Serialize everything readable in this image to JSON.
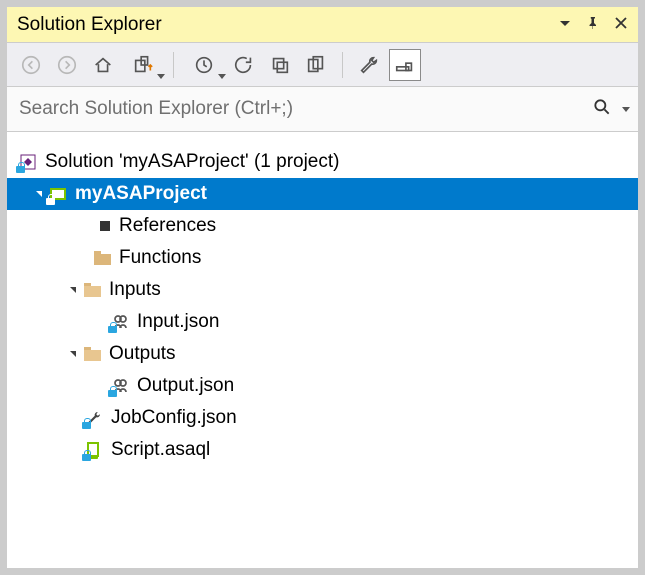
{
  "window": {
    "title": "Solution Explorer"
  },
  "search": {
    "placeholder": "Search Solution Explorer (Ctrl+;)"
  },
  "tree": {
    "solution_label": "Solution 'myASAProject' (1 project)",
    "project_label": "myASAProject",
    "references_label": "References",
    "functions_label": "Functions",
    "inputs_label": "Inputs",
    "input_file_label": "Input.json",
    "outputs_label": "Outputs",
    "output_file_label": "Output.json",
    "jobconfig_label": "JobConfig.json",
    "script_label": "Script.asaql"
  }
}
